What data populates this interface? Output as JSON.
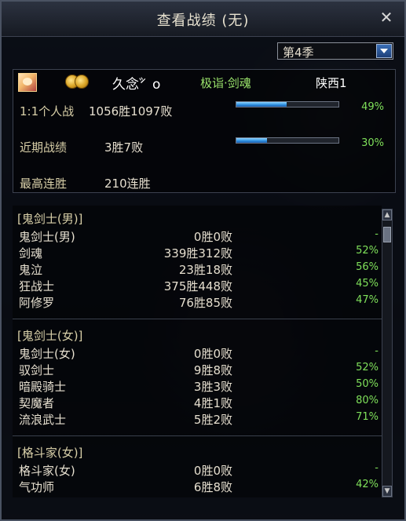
{
  "window": {
    "title": "查看战绩 (无)",
    "close_glyph": "✕"
  },
  "season_select": {
    "selected": "第4季"
  },
  "profile": {
    "name": "久念́゛o",
    "job": "极诣·剑魂",
    "server": "陕西1",
    "stats": [
      {
        "label": "1:1个人战",
        "value": "1056胜1097败",
        "rate": "49%",
        "fraction": 0.49
      },
      {
        "label": "近期战绩",
        "value": "3胜7败",
        "rate": "30%",
        "fraction": 0.3
      },
      {
        "label": "最高连胜",
        "value": "210连胜"
      }
    ]
  },
  "groups": [
    {
      "header": "[鬼剑士(男)]",
      "rows": [
        {
          "job": "鬼剑士(男)",
          "record": "0胜0败",
          "rate": "-"
        },
        {
          "job": "剑魂",
          "record": "339胜312败",
          "rate": "52%"
        },
        {
          "job": "鬼泣",
          "record": "23胜18败",
          "rate": "56%"
        },
        {
          "job": "狂战士",
          "record": "375胜448败",
          "rate": "45%"
        },
        {
          "job": "阿修罗",
          "record": "76胜85败",
          "rate": "47%"
        }
      ]
    },
    {
      "header": "[鬼剑士(女)]",
      "rows": [
        {
          "job": "鬼剑士(女)",
          "record": "0胜0败",
          "rate": "-"
        },
        {
          "job": "驭剑士",
          "record": "9胜8败",
          "rate": "52%"
        },
        {
          "job": "暗殿骑士",
          "record": "3胜3败",
          "rate": "50%"
        },
        {
          "job": "契魔者",
          "record": "4胜1败",
          "rate": "80%"
        },
        {
          "job": "流浪武士",
          "record": "5胜2败",
          "rate": "71%"
        }
      ]
    },
    {
      "header": "[格斗家(女)]",
      "rows": [
        {
          "job": "格斗家(女)",
          "record": "0胜0败",
          "rate": "-"
        },
        {
          "job": "气功师",
          "record": "6胜8败",
          "rate": "42%"
        }
      ]
    }
  ]
}
